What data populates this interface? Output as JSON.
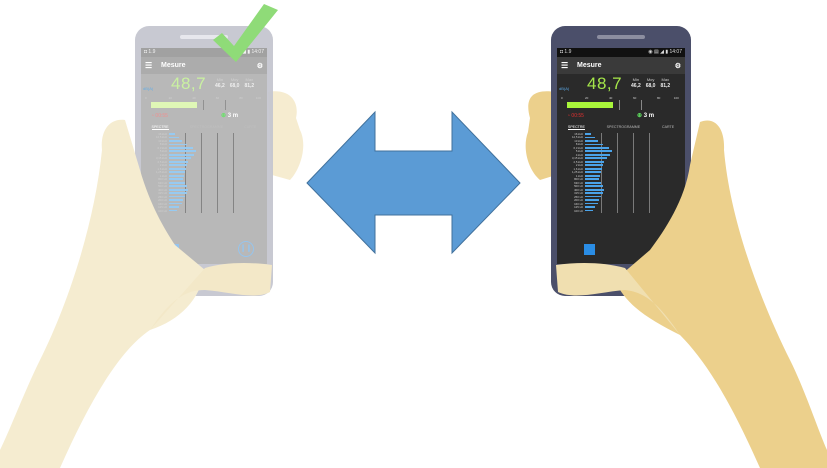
{
  "status": {
    "left": "◘ 1.9",
    "right": "◉ ▤ ◢ ▮ 14:07"
  },
  "app": {
    "title": "Mesure",
    "unit": "dB(A)",
    "level": "48,7",
    "stats": [
      {
        "label": "Min",
        "value": "46,2"
      },
      {
        "label": "Moy",
        "value": "68,0"
      },
      {
        "label": "Max",
        "value": "81,2"
      }
    ],
    "scale": [
      "0",
      "20",
      "40",
      "60",
      "80",
      "100"
    ],
    "timer": "00:55",
    "distance": "3 m",
    "tabs": [
      "SPECTRE",
      "SPECTROGRAMME",
      "CARTE"
    ],
    "spectrum_scale": [
      "0",
      "20",
      "40",
      "60",
      "80",
      "100"
    ],
    "spectrum_labels": [
      "16 kHz",
      "12,5 kHz",
      "10 kHz",
      "8 kHz",
      "6,3 kHz",
      "5 kHz",
      "4 kHz",
      "3,15 kHz",
      "2,5 kHz",
      "2 kHz",
      "1,6 kHz",
      "1,25 kHz",
      "1 kHz",
      "800 Hz",
      "630 Hz",
      "500 Hz",
      "400 Hz",
      "315 Hz",
      "250 Hz",
      "200 Hz",
      "160 Hz",
      "125 Hz",
      "100 Hz"
    ],
    "spectrum_values": [
      8,
      12,
      16,
      22,
      30,
      34,
      31,
      27,
      24,
      22,
      21,
      20,
      19,
      18,
      20,
      22,
      24,
      22,
      20,
      18,
      16,
      13,
      10
    ]
  },
  "colors": {
    "arrow": "#5b9bd5",
    "check": "#8fdb78",
    "hand": "#f0dfb0",
    "phone_dark": "#4b4f6a",
    "phone_light": "#c4c5cf"
  },
  "icons": {
    "menu": "☰",
    "tune": "⚙",
    "distance": "⊕",
    "timer": "◔",
    "pause": "❙❙"
  }
}
